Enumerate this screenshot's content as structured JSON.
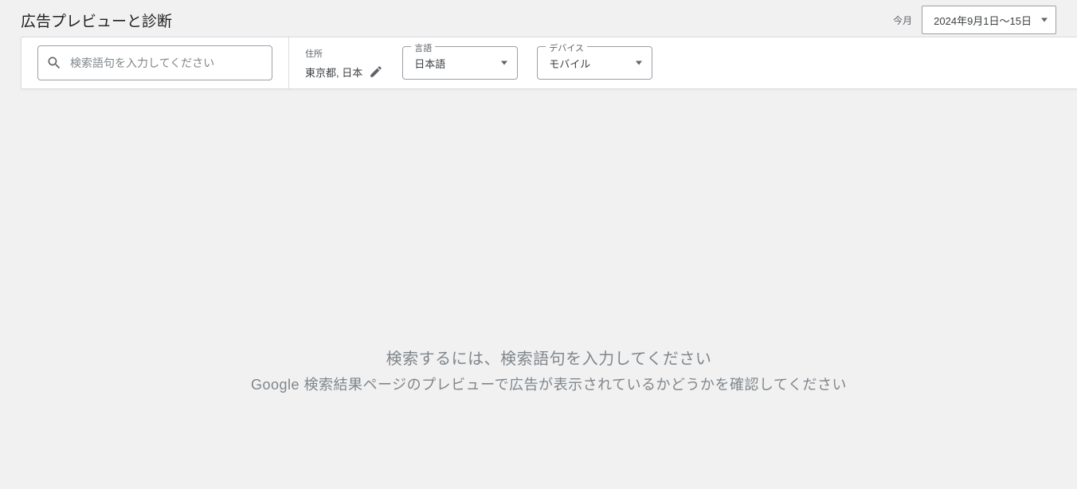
{
  "header": {
    "title": "広告プレビューと診断",
    "dateLabel": "今月",
    "dateRange": "2024年9月1日～15日"
  },
  "filters": {
    "searchPlaceholder": "検索語句を入力してください",
    "locationLabel": "住所",
    "locationValue": "東京都, 日本",
    "languageLabel": "言語",
    "languageValue": "日本語",
    "deviceLabel": "デバイス",
    "deviceValue": "モバイル"
  },
  "emptyState": {
    "title": "検索するには、検索語句を入力してください",
    "subtitle": "Google 検索結果ページのプレビューで広告が表示されているかどうかを確認してください"
  }
}
